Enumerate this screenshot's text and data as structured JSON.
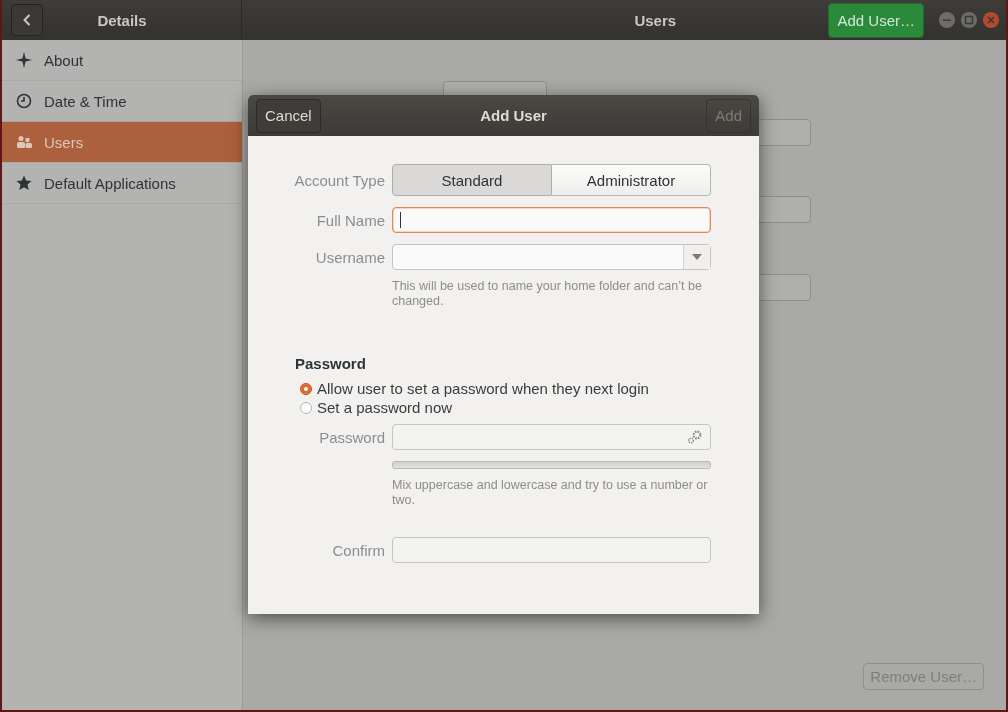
{
  "window": {
    "title": "Users"
  },
  "sidebar": {
    "title": "Details",
    "items": [
      {
        "label": "About",
        "selected": false
      },
      {
        "label": "Date & Time",
        "selected": false
      },
      {
        "label": "Users",
        "selected": true
      },
      {
        "label": "Default Applications",
        "selected": false
      }
    ]
  },
  "header_button": {
    "label": "Add User…"
  },
  "remove_button": {
    "label": "Remove User…",
    "disabled": true
  },
  "dialog": {
    "title": "Add User",
    "cancel": "Cancel",
    "add": {
      "label": "Add",
      "disabled": true
    },
    "account_type": {
      "label": "Account Type",
      "options": [
        {
          "label": "Standard",
          "selected": true
        },
        {
          "label": "Administrator",
          "selected": false
        }
      ]
    },
    "full_name": {
      "label": "Full Name",
      "focused": true
    },
    "username": {
      "label": "Username"
    },
    "username_hint": "This will be used to name your home folder and can’t be changed.",
    "password_section": {
      "title": "Password",
      "options": [
        {
          "label": "Allow user to set a password when they next login",
          "selected": true
        },
        {
          "label": "Set a password now",
          "selected": false
        }
      ],
      "password": {
        "label": "Password"
      },
      "strength": {
        "level": 0
      },
      "hint": "Mix uppercase and lowercase and try to use a number or two.",
      "confirm": {
        "label": "Confirm"
      }
    }
  }
}
